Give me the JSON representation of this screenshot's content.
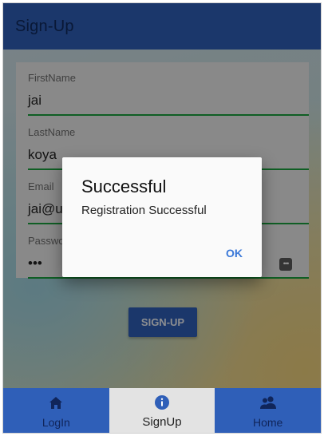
{
  "header": {
    "title": "Sign-Up"
  },
  "form": {
    "first_name": {
      "label": "FirstName",
      "value": "jai"
    },
    "last_name": {
      "label": "LastName",
      "value": "koya"
    },
    "email": {
      "label": "Email",
      "value": "jai@ur"
    },
    "password": {
      "label": "Passwo",
      "value": "•••"
    },
    "submit_label": "SIGN-UP"
  },
  "dialog": {
    "title": "Successful",
    "message": "Registration Successful",
    "ok_label": "OK"
  },
  "tabs": [
    {
      "label": "LogIn",
      "icon": "home-icon"
    },
    {
      "label": "SignUp",
      "icon": "info-icon",
      "active": true
    },
    {
      "label": "Home",
      "icon": "people-icon"
    }
  ],
  "colors": {
    "primary": "#2f5fb8",
    "field_underline": "#1aa23f",
    "dialog_action": "#3a78d8"
  }
}
